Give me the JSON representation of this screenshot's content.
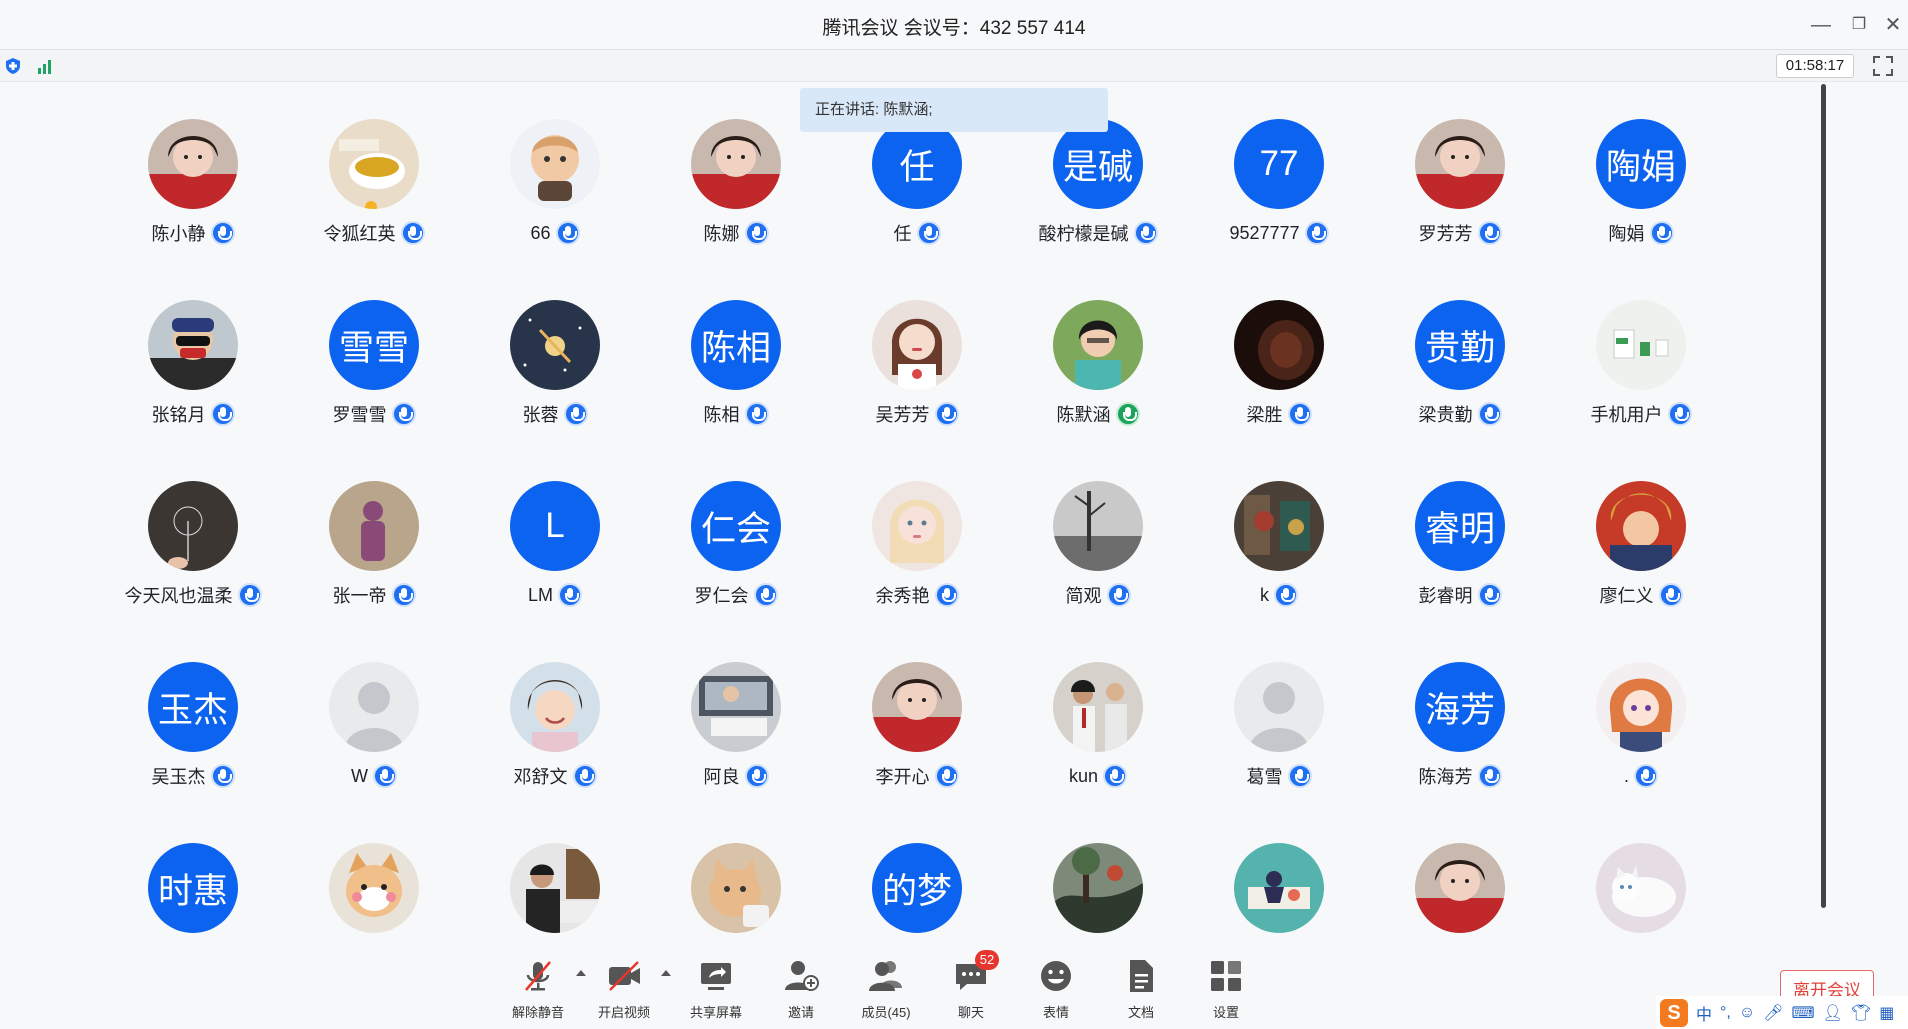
{
  "window": {
    "title": "腾讯会议 会议号：432 557 414"
  },
  "status": {
    "timer": "01:58:17"
  },
  "speaking_banner": "正在讲话: 陈默涵;",
  "participants": [
    {
      "name": "陈小静",
      "avatar_type": "photo",
      "photo": "girl-red"
    },
    {
      "name": "令狐红英",
      "avatar_type": "photo",
      "photo": "tea"
    },
    {
      "name": "66",
      "avatar_type": "photo",
      "photo": "cartoon-boy"
    },
    {
      "name": "陈娜",
      "avatar_type": "photo",
      "photo": "girl-red"
    },
    {
      "name": "任",
      "avatar_type": "text",
      "avatar_text": "任"
    },
    {
      "name": "酸柠檬是碱",
      "avatar_type": "text",
      "avatar_text": "是碱"
    },
    {
      "name": "9527777",
      "avatar_type": "text",
      "avatar_text": "77"
    },
    {
      "name": "罗芳芳",
      "avatar_type": "photo",
      "photo": "girl-red"
    },
    {
      "name": "陶娟",
      "avatar_type": "text",
      "avatar_text": "陶娟"
    },
    {
      "name": "张铭月",
      "avatar_type": "photo",
      "photo": "masked-kid"
    },
    {
      "name": "罗雪雪",
      "avatar_type": "text",
      "avatar_text": "雪雪"
    },
    {
      "name": "张蓉",
      "avatar_type": "photo",
      "photo": "space"
    },
    {
      "name": "陈相",
      "avatar_type": "text",
      "avatar_text": "陈相"
    },
    {
      "name": "吴芳芳",
      "avatar_type": "photo",
      "photo": "woman-portrait"
    },
    {
      "name": "陈默涵",
      "avatar_type": "photo",
      "photo": "woman-green",
      "speaking": true
    },
    {
      "name": "梁胜",
      "avatar_type": "photo",
      "photo": "dark-face"
    },
    {
      "name": "梁贵勤",
      "avatar_type": "text",
      "avatar_text": "贵勤"
    },
    {
      "name": "手机用户",
      "avatar_type": "photo",
      "photo": "cups"
    },
    {
      "name": "今天风也温柔",
      "avatar_type": "photo",
      "photo": "dandelion"
    },
    {
      "name": "张一帝",
      "avatar_type": "photo",
      "photo": "purple-figure"
    },
    {
      "name": "LM",
      "avatar_type": "text",
      "avatar_text": "L"
    },
    {
      "name": "罗仁会",
      "avatar_type": "text",
      "avatar_text": "仁会"
    },
    {
      "name": "余秀艳",
      "avatar_type": "photo",
      "photo": "doll-girl"
    },
    {
      "name": "简观",
      "avatar_type": "photo",
      "photo": "bw-tree"
    },
    {
      "name": "k",
      "avatar_type": "photo",
      "photo": "game-art"
    },
    {
      "name": "彭睿明",
      "avatar_type": "text",
      "avatar_text": "睿明"
    },
    {
      "name": "廖仁义",
      "avatar_type": "photo",
      "photo": "anime-red"
    },
    {
      "name": "吴玉杰",
      "avatar_type": "text",
      "avatar_text": "玉杰"
    },
    {
      "name": "W",
      "avatar_type": "photo",
      "photo": "default"
    },
    {
      "name": "邓舒文",
      "avatar_type": "photo",
      "photo": "child-smile"
    },
    {
      "name": "阿良",
      "avatar_type": "photo",
      "photo": "car-kid"
    },
    {
      "name": "李开心",
      "avatar_type": "photo",
      "photo": "girl-red"
    },
    {
      "name": "kun",
      "avatar_type": "photo",
      "photo": "school-boys"
    },
    {
      "name": "葛雪",
      "avatar_type": "photo",
      "photo": "default"
    },
    {
      "name": "陈海芳",
      "avatar_type": "text",
      "avatar_text": "海芳"
    },
    {
      "name": ".",
      "avatar_type": "photo",
      "photo": "anime-girl"
    },
    {
      "name": "",
      "avatar_type": "text",
      "avatar_text": "时惠"
    },
    {
      "name": "",
      "avatar_type": "photo",
      "photo": "cat-orange"
    },
    {
      "name": "",
      "avatar_type": "photo",
      "photo": "man-desk"
    },
    {
      "name": "",
      "avatar_type": "photo",
      "photo": "cat-cup"
    },
    {
      "name": "",
      "avatar_type": "text",
      "avatar_text": "的梦"
    },
    {
      "name": "",
      "avatar_type": "photo",
      "photo": "forest-art"
    },
    {
      "name": "",
      "avatar_type": "photo",
      "photo": "teal-illus"
    },
    {
      "name": "",
      "avatar_type": "photo",
      "photo": "girl-red"
    },
    {
      "name": "",
      "avatar_type": "photo",
      "photo": "white-cat"
    }
  ],
  "toolbar": {
    "unmute": "解除静音",
    "video": "开启视频",
    "share": "共享屏幕",
    "invite": "邀请",
    "members": "成员(45)",
    "chat": "聊天",
    "chat_badge": "52",
    "reaction": "表情",
    "docs": "文档",
    "settings": "设置",
    "leave": "离开会议"
  },
  "ime": {
    "logo": "S",
    "lang": "中",
    "punct": "°,"
  },
  "colors": {
    "accent": "#0c63ef",
    "leave": "#e0433b",
    "badge": "#e8352e"
  }
}
